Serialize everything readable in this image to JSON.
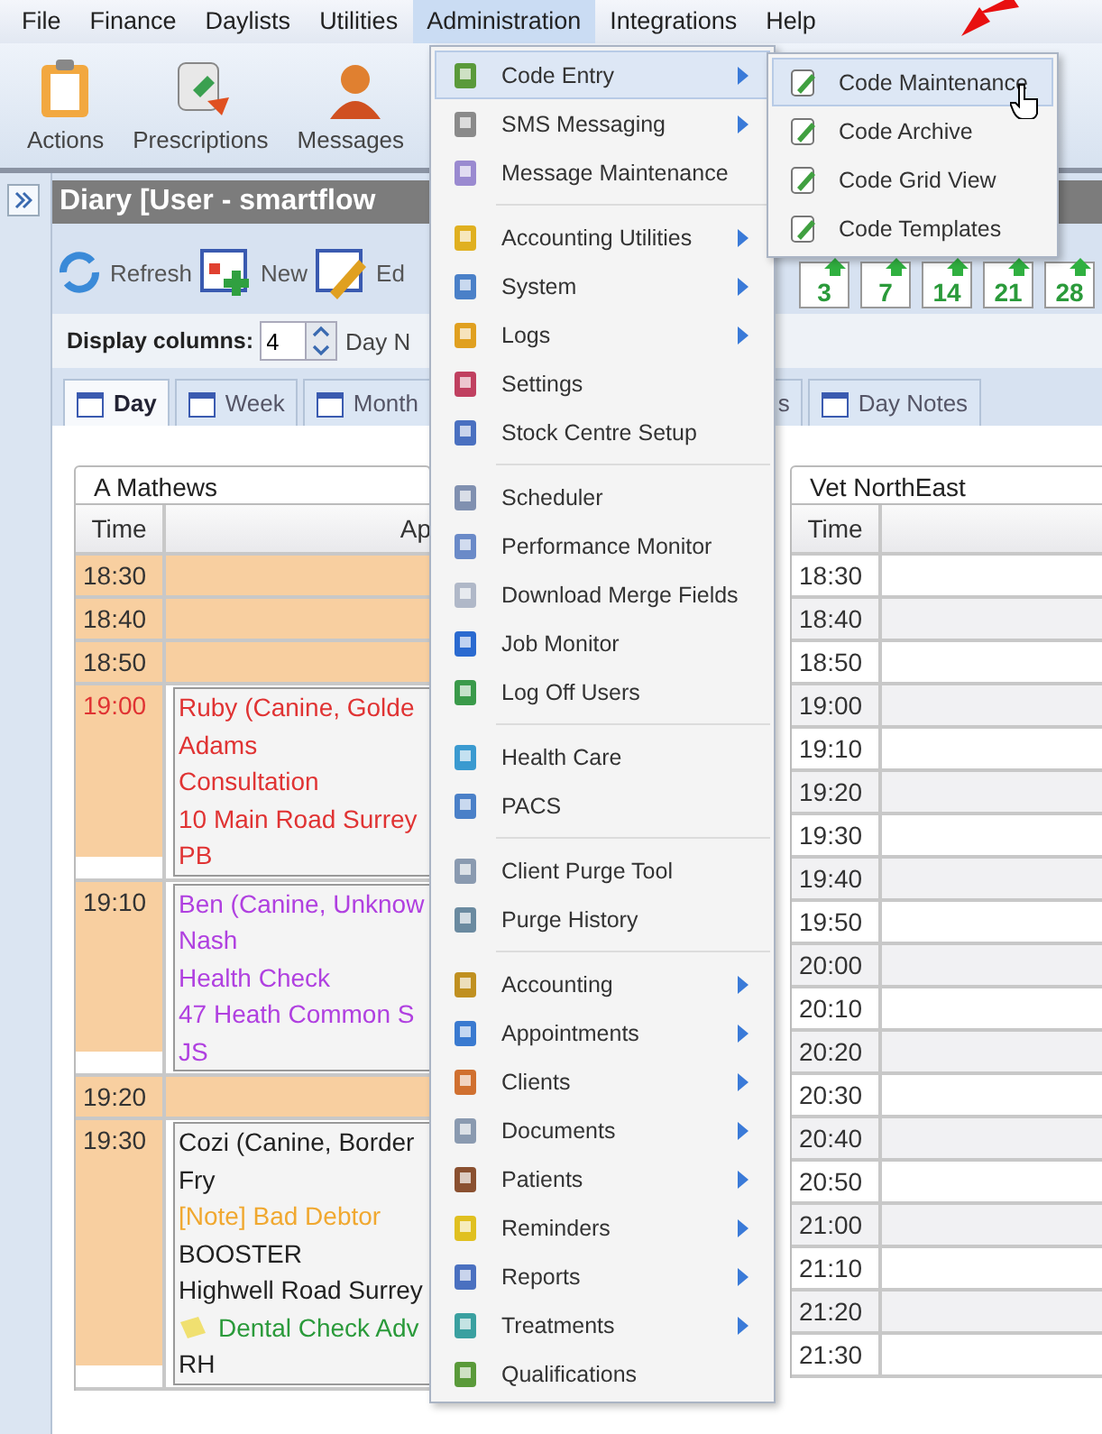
{
  "menu_bar": [
    {
      "label": "File",
      "selected": false
    },
    {
      "label": "Finance",
      "selected": false
    },
    {
      "label": "Daylists",
      "selected": false
    },
    {
      "label": "Utilities",
      "selected": false
    },
    {
      "label": "Administration",
      "selected": true
    },
    {
      "label": "Integrations",
      "selected": false
    },
    {
      "label": "Help",
      "selected": false
    }
  ],
  "toolbar": [
    "Actions",
    "Prescriptions",
    "Messages"
  ],
  "diary": {
    "title": "Diary [User - smartflow",
    "actions": [
      "Refresh",
      "New",
      "Ed"
    ],
    "period_buttons": [
      "3",
      "7",
      "14",
      "21",
      "28"
    ],
    "display_columns": {
      "label": "Display columns:",
      "value": "4"
    },
    "day_label": "Day N",
    "tabs": [
      {
        "label": "Day",
        "selected": true
      },
      {
        "label": "Week",
        "selected": false
      },
      {
        "label": "Month",
        "selected": false
      },
      {
        "label": "s",
        "selected": false
      },
      {
        "label": "Day Notes",
        "selected": false
      }
    ],
    "columns": [
      {
        "name": "A Mathews",
        "time_header": "Time",
        "appt_header": "Ap",
        "slots": [
          {
            "time": "18:30",
            "alert": false
          },
          {
            "time": "18:40",
            "alert": false
          },
          {
            "time": "18:50",
            "alert": false
          },
          {
            "time": "19:00",
            "alert": true,
            "color": "#e03333",
            "lines": [
              {
                "kind": "text",
                "text": "Ruby (Canine, Golde"
              },
              {
                "kind": "text",
                "text": "Adams"
              },
              {
                "kind": "text",
                "text": "Consultation"
              },
              {
                "kind": "text",
                "text": "10 Main Road Surrey"
              },
              {
                "kind": "text",
                "text": "PB"
              }
            ]
          },
          {
            "time": "19:10",
            "alert": false,
            "color": "#b040e0",
            "lines": [
              {
                "kind": "text",
                "text": "Ben (Canine, Unknow"
              },
              {
                "kind": "text",
                "text": "Nash"
              },
              {
                "kind": "text",
                "text": "Health Check"
              },
              {
                "kind": "text",
                "text": "47 Heath Common S"
              },
              {
                "kind": "text",
                "text": "JS"
              }
            ]
          },
          {
            "time": "19:20",
            "alert": false
          },
          {
            "time": "19:30",
            "alert": false,
            "color": "#222222",
            "lines": [
              {
                "kind": "text",
                "text": "Cozi (Canine, Border"
              },
              {
                "kind": "text",
                "text": "Fry"
              },
              {
                "kind": "note",
                "text": "[Note] Bad Debtor"
              },
              {
                "kind": "text",
                "text": "BOOSTER"
              },
              {
                "kind": "text",
                "text": "Highwell Road Surrey"
              },
              {
                "kind": "reminder",
                "text": "Dental Check Adv"
              },
              {
                "kind": "text",
                "text": "RH"
              }
            ]
          }
        ]
      },
      {
        "name": "Vet NorthEast",
        "time_header": "Time",
        "slots": [
          {
            "time": "18:30"
          },
          {
            "time": "18:40"
          },
          {
            "time": "18:50"
          },
          {
            "time": "19:00"
          },
          {
            "time": "19:10"
          },
          {
            "time": "19:20"
          },
          {
            "time": "19:30"
          },
          {
            "time": "19:40"
          },
          {
            "time": "19:50"
          },
          {
            "time": "20:00"
          },
          {
            "time": "20:10"
          },
          {
            "time": "20:20"
          },
          {
            "time": "20:30"
          },
          {
            "time": "20:40"
          },
          {
            "time": "20:50"
          },
          {
            "time": "21:00"
          },
          {
            "time": "21:10"
          },
          {
            "time": "21:20"
          },
          {
            "time": "21:30"
          }
        ]
      }
    ]
  },
  "admin_menu": [
    {
      "kind": "item",
      "label": "Code Entry",
      "submenu": true,
      "selected": true
    },
    {
      "kind": "item",
      "label": "SMS Messaging",
      "submenu": true,
      "selected": false
    },
    {
      "kind": "item",
      "label": "Message Maintenance",
      "submenu": false,
      "selected": false
    },
    {
      "kind": "separator"
    },
    {
      "kind": "item",
      "label": "Accounting Utilities",
      "submenu": true,
      "selected": false
    },
    {
      "kind": "item",
      "label": "System",
      "submenu": true,
      "selected": false
    },
    {
      "kind": "item",
      "label": "Logs",
      "submenu": true,
      "selected": false
    },
    {
      "kind": "item",
      "label": "Settings",
      "submenu": false,
      "selected": false
    },
    {
      "kind": "item",
      "label": "Stock Centre Setup",
      "submenu": false,
      "selected": false
    },
    {
      "kind": "separator"
    },
    {
      "kind": "item",
      "label": "Scheduler",
      "submenu": false,
      "selected": false
    },
    {
      "kind": "item",
      "label": "Performance Monitor",
      "submenu": false,
      "selected": false
    },
    {
      "kind": "item",
      "label": "Download Merge Fields",
      "submenu": false,
      "selected": false
    },
    {
      "kind": "item",
      "label": "Job Monitor",
      "submenu": false,
      "selected": false
    },
    {
      "kind": "item",
      "label": "Log Off Users",
      "submenu": false,
      "selected": false
    },
    {
      "kind": "separator"
    },
    {
      "kind": "item",
      "label": "Health Care",
      "submenu": false,
      "selected": false
    },
    {
      "kind": "item",
      "label": "PACS",
      "submenu": false,
      "selected": false
    },
    {
      "kind": "separator"
    },
    {
      "kind": "item",
      "label": "Client Purge Tool",
      "submenu": false,
      "selected": false
    },
    {
      "kind": "item",
      "label": "Purge History",
      "submenu": false,
      "selected": false
    },
    {
      "kind": "separator"
    },
    {
      "kind": "item",
      "label": "Accounting",
      "submenu": true,
      "selected": false
    },
    {
      "kind": "item",
      "label": "Appointments",
      "submenu": true,
      "selected": false
    },
    {
      "kind": "item",
      "label": "Clients",
      "submenu": true,
      "selected": false
    },
    {
      "kind": "item",
      "label": "Documents",
      "submenu": true,
      "selected": false
    },
    {
      "kind": "item",
      "label": "Patients",
      "submenu": true,
      "selected": false
    },
    {
      "kind": "item",
      "label": "Reminders",
      "submenu": true,
      "selected": false
    },
    {
      "kind": "item",
      "label": "Reports",
      "submenu": true,
      "selected": false
    },
    {
      "kind": "item",
      "label": "Treatments",
      "submenu": true,
      "selected": false
    },
    {
      "kind": "item",
      "label": "Qualifications",
      "submenu": false,
      "selected": false
    }
  ],
  "code_submenu": [
    {
      "label": "Code Maintenance",
      "selected": true
    },
    {
      "label": "Code Archive",
      "selected": false
    },
    {
      "label": "Code Grid View",
      "selected": false
    },
    {
      "label": "Code Templates",
      "selected": false
    }
  ]
}
